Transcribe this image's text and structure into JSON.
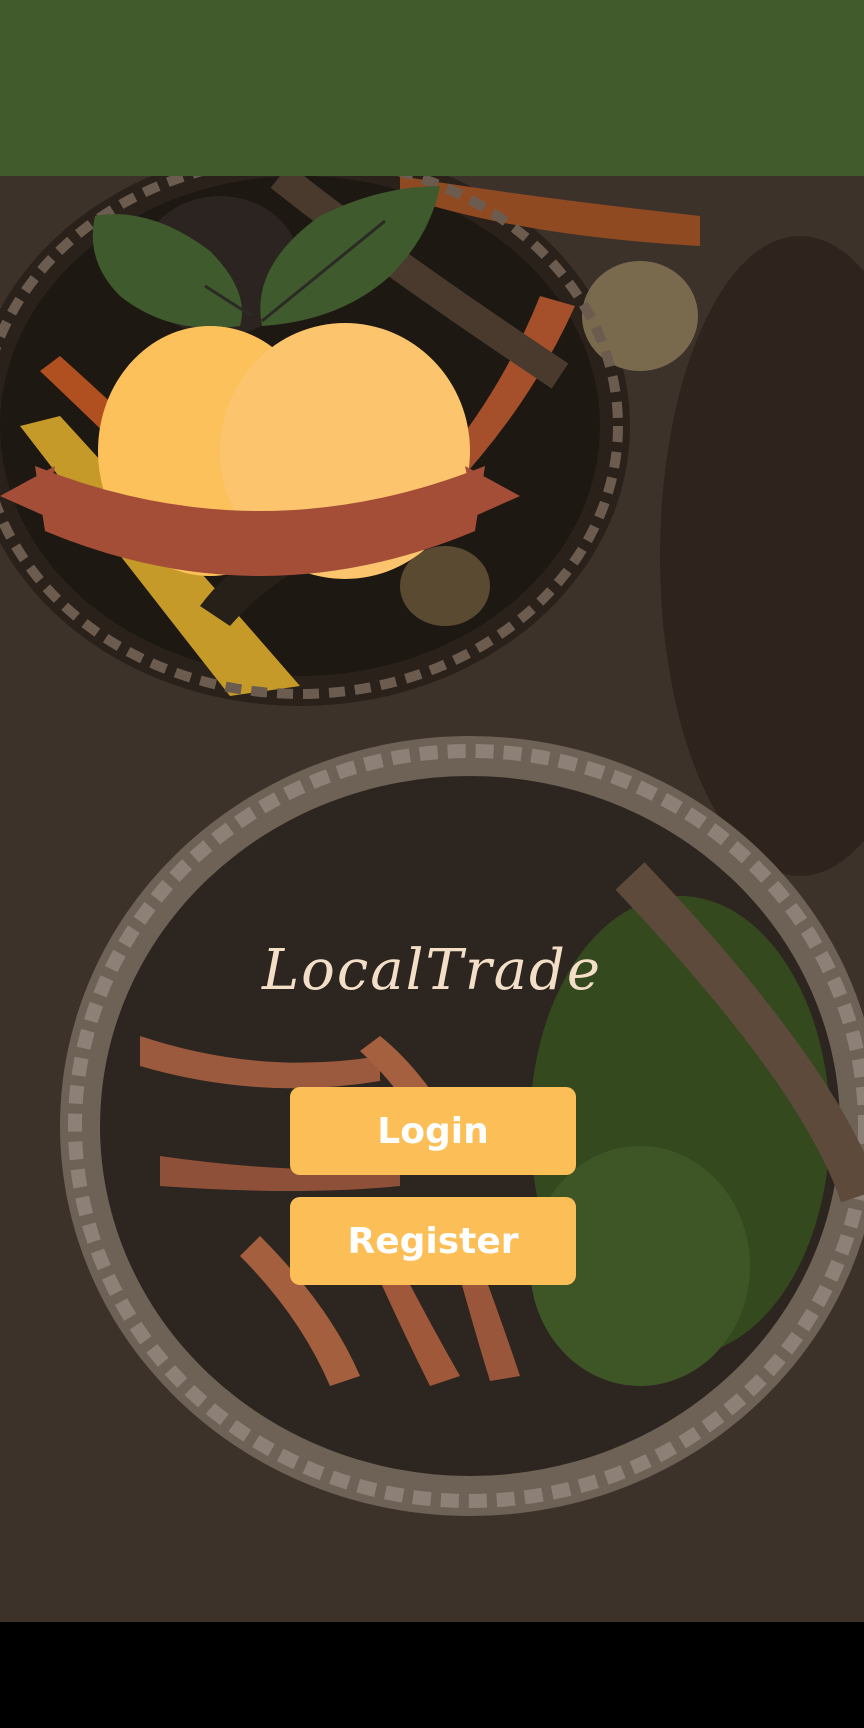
{
  "app": {
    "name": "LocalTrade"
  },
  "actions": {
    "login_label": "Login",
    "register_label": "Register"
  },
  "colors": {
    "status_bar": "#415b2d",
    "button": "#fcbf58",
    "button_text": "#ffffff",
    "leaf": "#3f5a2c",
    "fruit_left": "#fdc15b",
    "fruit_right": "#fcc46c",
    "ribbon": "#a44e38",
    "ribbon_text": "#f3dfc8",
    "nav_bar": "#000000"
  },
  "icons": {
    "logo": "lemon-pair-logo",
    "background": "vegetable-basket-photo"
  }
}
